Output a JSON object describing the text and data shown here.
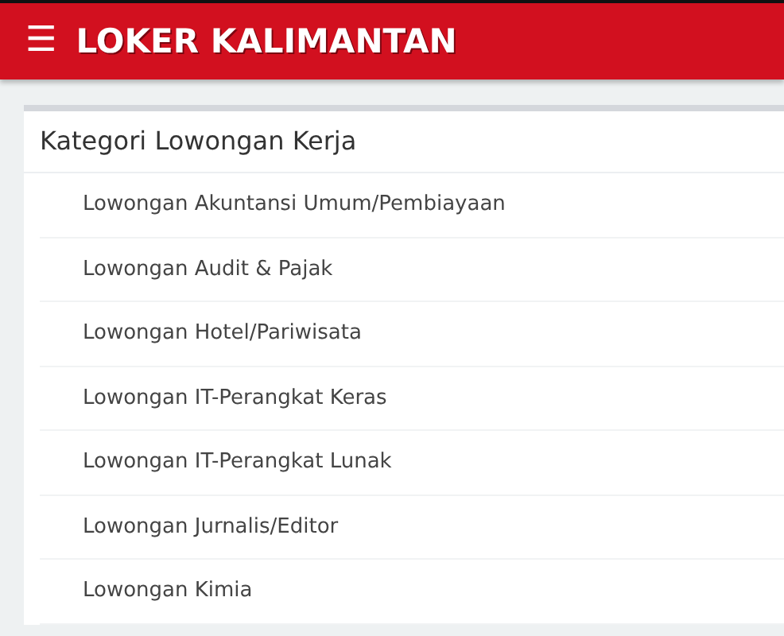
{
  "header": {
    "menu_icon": "☰",
    "title": "LOKER KALIMANTAN"
  },
  "card": {
    "title": "Kategori Lowongan Kerja",
    "items": [
      "Lowongan Akuntansi Umum/Pembiayaan",
      "Lowongan Audit & Pajak",
      "Lowongan Hotel/Pariwisata",
      "Lowongan IT-Perangkat Keras",
      "Lowongan IT-Perangkat Lunak",
      "Lowongan Jurnalis/Editor",
      "Lowongan Kimia"
    ]
  }
}
